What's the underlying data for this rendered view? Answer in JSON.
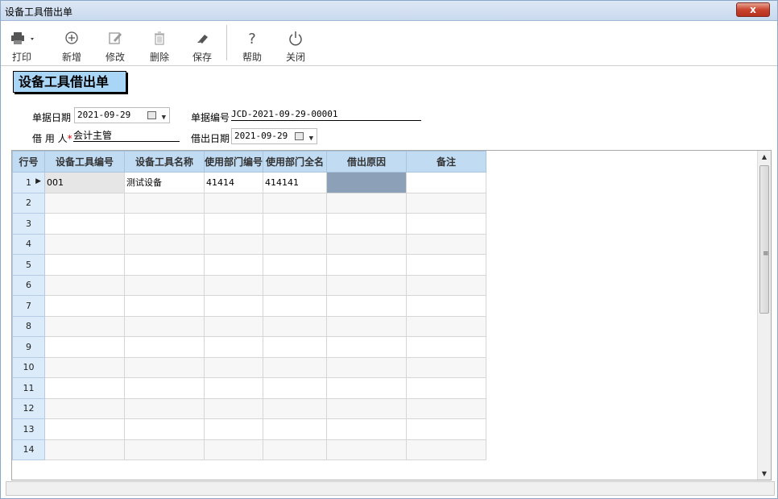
{
  "window": {
    "title": "设备工具借出单",
    "close_label": "x"
  },
  "toolbar": {
    "items": [
      {
        "label": "打印",
        "icon": "printer-icon"
      },
      {
        "label": "新增",
        "icon": "add-circle-icon"
      },
      {
        "label": "修改",
        "icon": "edit-icon"
      },
      {
        "label": "删除",
        "icon": "trash-icon"
      },
      {
        "label": "保存",
        "icon": "save-icon"
      },
      {
        "label": "帮助",
        "icon": "help-icon"
      },
      {
        "label": "关闭",
        "icon": "power-icon"
      }
    ]
  },
  "form": {
    "title": "设备工具借出单",
    "doc_date_label": "单据日期",
    "doc_date_value": "2021-09-29",
    "doc_no_label": "单据编号",
    "doc_no_value": "JCD-2021-09-29-00001",
    "borrower_label": "借 用 人",
    "borrower_required": "*",
    "borrower_value": "会计主管",
    "lend_date_label": "借出日期",
    "lend_date_value": "2021-09-29"
  },
  "grid": {
    "columns": [
      "行号",
      "设备工具编号",
      "设备工具名称",
      "使用部门编号",
      "使用部门全名",
      "借出原因",
      "备注"
    ],
    "rows": [
      [
        "1",
        "001",
        "测试设备",
        "41414",
        "414141",
        "",
        ""
      ],
      [
        "2",
        "",
        "",
        "",
        "",
        "",
        ""
      ],
      [
        "3",
        "",
        "",
        "",
        "",
        "",
        ""
      ],
      [
        "4",
        "",
        "",
        "",
        "",
        "",
        ""
      ],
      [
        "5",
        "",
        "",
        "",
        "",
        "",
        ""
      ],
      [
        "6",
        "",
        "",
        "",
        "",
        "",
        ""
      ],
      [
        "7",
        "",
        "",
        "",
        "",
        "",
        ""
      ],
      [
        "8",
        "",
        "",
        "",
        "",
        "",
        ""
      ],
      [
        "9",
        "",
        "",
        "",
        "",
        "",
        ""
      ],
      [
        "10",
        "",
        "",
        "",
        "",
        "",
        ""
      ],
      [
        "11",
        "",
        "",
        "",
        "",
        "",
        ""
      ],
      [
        "12",
        "",
        "",
        "",
        "",
        "",
        ""
      ],
      [
        "13",
        "",
        "",
        "",
        "",
        "",
        ""
      ],
      [
        "14",
        "",
        "",
        "",
        "",
        "",
        ""
      ]
    ]
  },
  "colors": {
    "header_bg": "#c1dbf3",
    "title_badge_bg": "#a9d6f7",
    "selected_cell": "#8ca0b7"
  }
}
